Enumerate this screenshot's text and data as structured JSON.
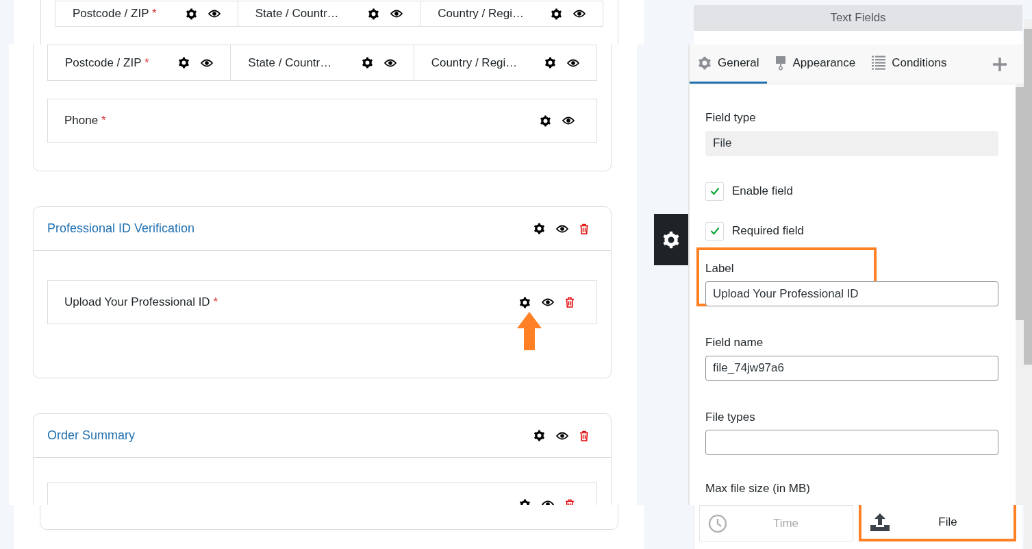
{
  "background_form": {
    "address_fields": [
      {
        "label": "Postcode / ZIP",
        "required_mark": "*"
      },
      {
        "label": "State / Countr…"
      },
      {
        "label": "Country / Regi…"
      }
    ]
  },
  "form": {
    "address_fields": [
      {
        "label": "Postcode / ZIP",
        "required_mark": "*"
      },
      {
        "label": "State / Countr…"
      },
      {
        "label": "Country / Regi…"
      }
    ],
    "fields": [
      {
        "label": "Phone",
        "required_mark": "*",
        "deletable": false
      }
    ],
    "sections": [
      {
        "title": "Professional ID Verification",
        "fields": [
          {
            "label": "Upload Your Professional ID",
            "required_mark": "*",
            "deletable": true
          }
        ]
      },
      {
        "title": "Order Summary",
        "fields": [
          {
            "deletable": true
          }
        ]
      }
    ]
  },
  "background_panel": {
    "title": "Text Fields"
  },
  "settings": {
    "tabs": [
      {
        "kind": "general",
        "label": "General",
        "selected": true
      },
      {
        "kind": "appearance",
        "label": "Appearance",
        "selected": false
      },
      {
        "kind": "conditions",
        "label": "Conditions",
        "selected": false
      }
    ],
    "field_type": {
      "label": "Field type",
      "value": "File"
    },
    "checkboxes": [
      {
        "label": "Enable field",
        "checked": true
      },
      {
        "label": "Required field",
        "checked": true
      }
    ],
    "inputs": [
      {
        "label": "Label",
        "value": "Upload Your Professional ID",
        "highlighted": true
      },
      {
        "label": "Field name",
        "value": "file_74jw97a6",
        "highlighted": false
      },
      {
        "label": "File types",
        "highlighted": false
      }
    ],
    "next_label": "Max file size (in MB)"
  },
  "field_types": [
    {
      "kind": "time",
      "label": "Time",
      "disabled": true,
      "highlighted": false
    },
    {
      "kind": "file",
      "label": "File",
      "disabled": false,
      "highlighted": true
    }
  ]
}
